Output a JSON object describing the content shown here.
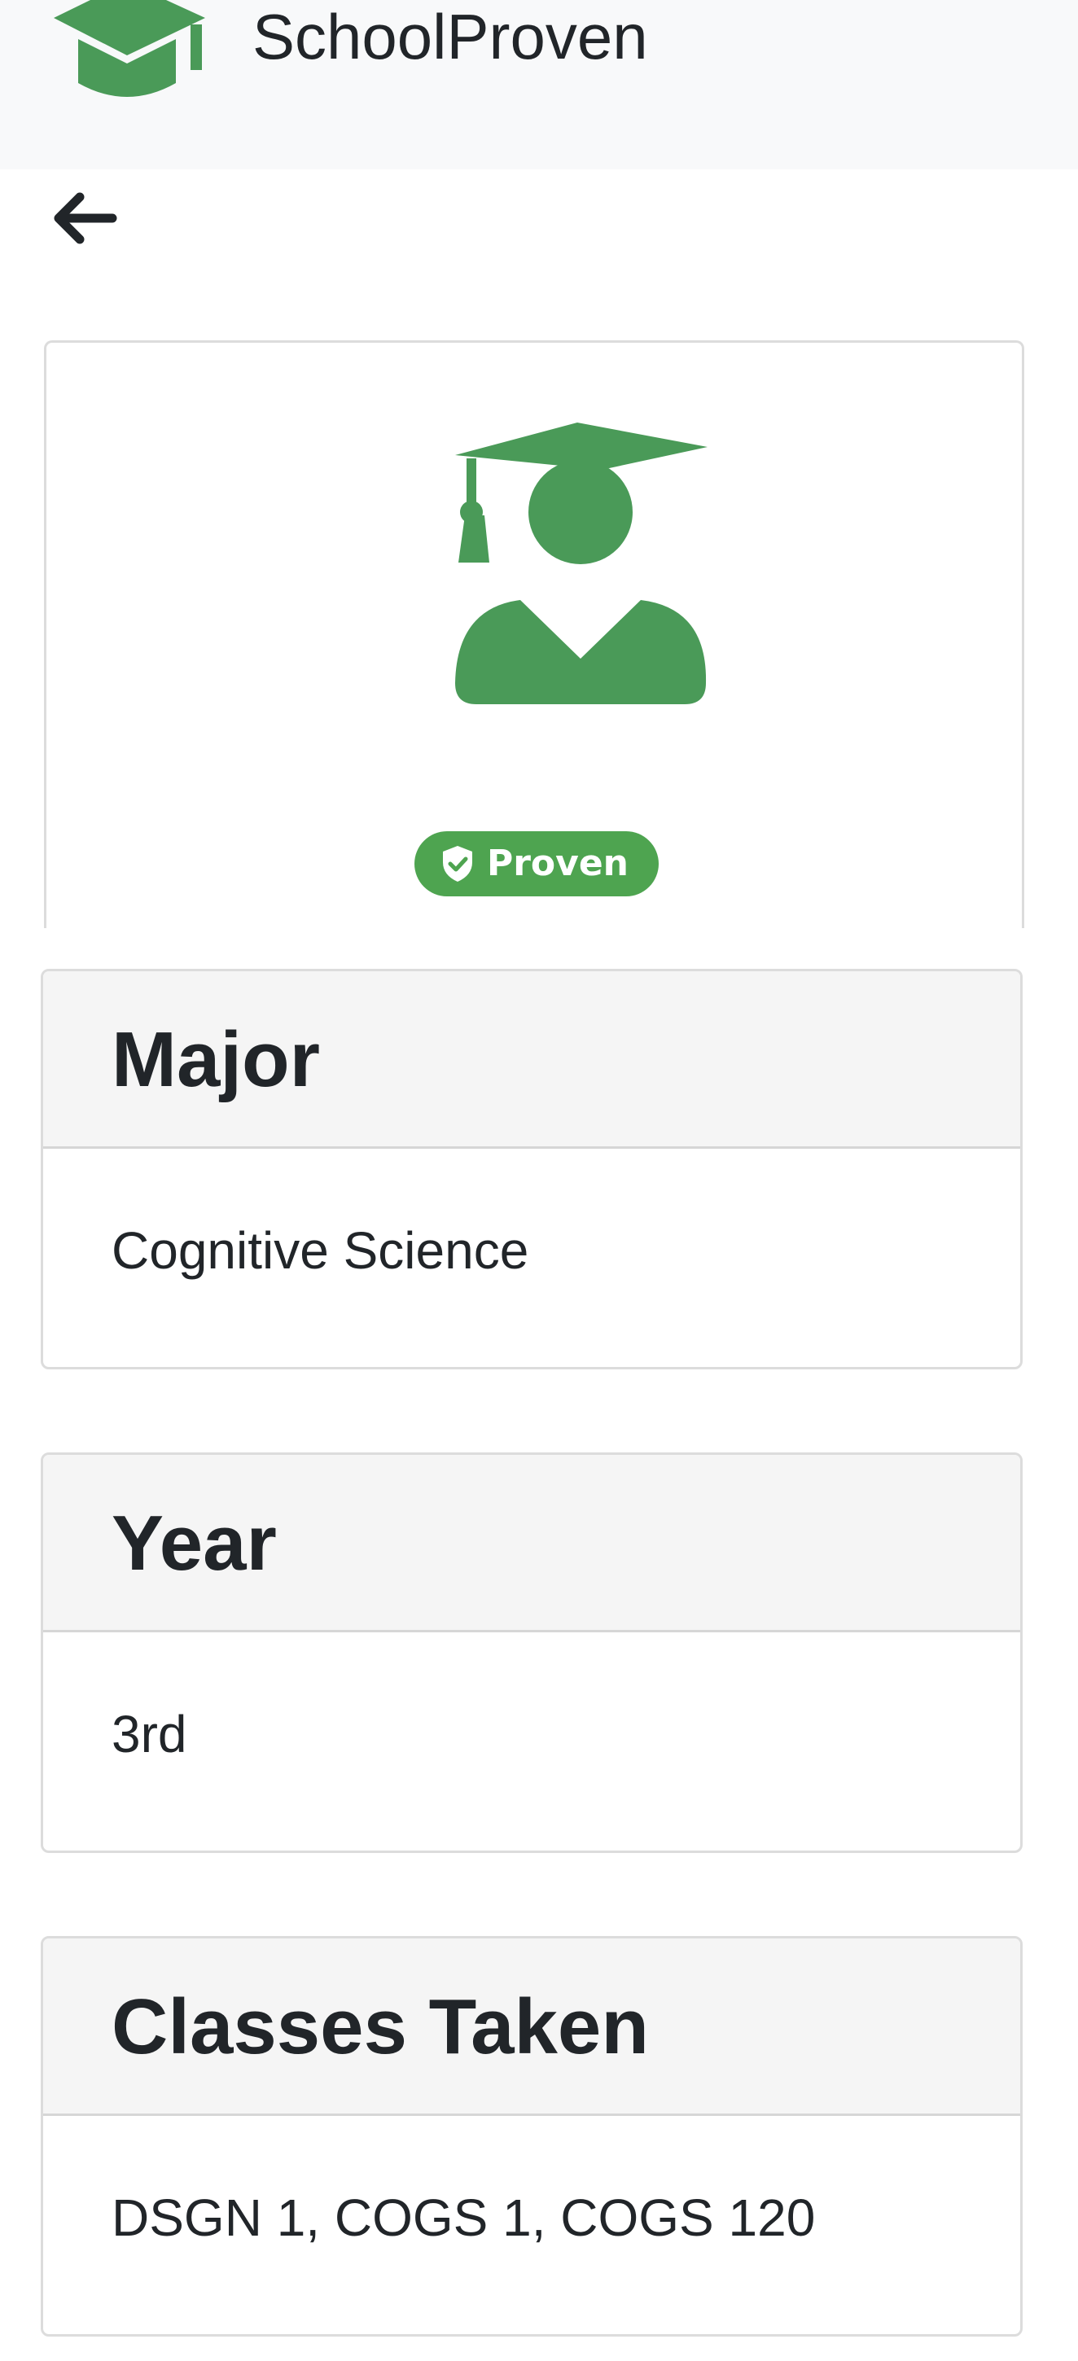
{
  "app": {
    "brand_name": "SchoolProven",
    "brand_color": "#4a9a58"
  },
  "nav": {
    "back_icon": "arrow-left-icon"
  },
  "profile": {
    "avatar_icon": "user-graduate-icon",
    "avatar_color": "#4a9a58",
    "badge": {
      "label": "Proven",
      "icon": "shield-check-icon",
      "color": "#4ea450"
    }
  },
  "details": [
    {
      "title": "Major",
      "value": "Cognitive Science"
    },
    {
      "title": "Year",
      "value": "3rd"
    },
    {
      "title": "Classes Taken",
      "value": "DSGN 1, COGS 1, COGS 120"
    }
  ]
}
